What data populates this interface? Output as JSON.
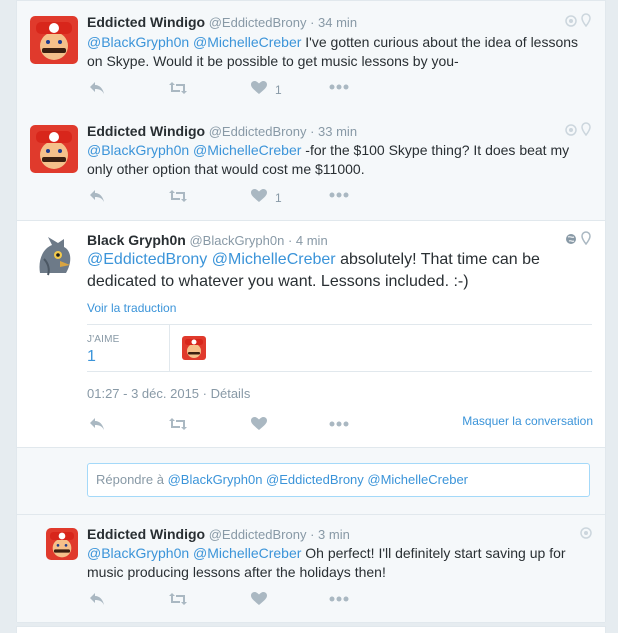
{
  "tweets": [
    {
      "name": "Eddicted Windigo",
      "handle": "@EddictedBrony",
      "time": "· 34 min",
      "mentions": [
        "@BlackGryph0n",
        "@MichelleCreber"
      ],
      "text": "I've gotten curious about the idea of lessons on Skype. Would it be possible to get music lessons by you-",
      "like_count": "1"
    },
    {
      "name": "Eddicted Windigo",
      "handle": "@EddictedBrony",
      "time": "· 33 min",
      "mentions": [
        "@BlackGryph0n",
        "@MichelleCreber"
      ],
      "text": "-for the $100 Skype thing? It does beat my only other option that would cost me $11000.",
      "like_count": "1"
    },
    {
      "name": "Black Gryph0n",
      "handle": "@BlackGryph0n",
      "time": "· 4 min",
      "mentions": [
        "@EddictedBrony",
        "@MichelleCreber"
      ],
      "text": "absolutely! That time can be dedicated to whatever you want. Lessons included. :-)",
      "translate": "Voir la traduction",
      "likes_label": "J'AIME",
      "likes_value": "1",
      "date": "01:27 - 3 déc. 2015 · Détails",
      "hide_conversation": "Masquer la conversation"
    },
    {
      "name": "Eddicted Windigo",
      "handle": "@EddictedBrony",
      "time": "· 3 min",
      "mentions": [
        "@BlackGryph0n",
        "@MichelleCreber"
      ],
      "text": "Oh perfect! I'll definitely start saving up for music producing lessons after the holidays then!"
    }
  ],
  "reply_box": {
    "prefix": "Répondre à",
    "mentions": "@BlackGryph0n @EddictedBrony @MichelleCreber"
  },
  "colors": {
    "link": "#3b94d9",
    "muted": "#8899a6",
    "icon": "#aab8c2",
    "bg_alt": "#f5f8fa"
  },
  "icons": [
    "reply-icon",
    "retweet-icon",
    "heart-icon",
    "more-icon",
    "globe-icon",
    "location-pin-icon"
  ]
}
